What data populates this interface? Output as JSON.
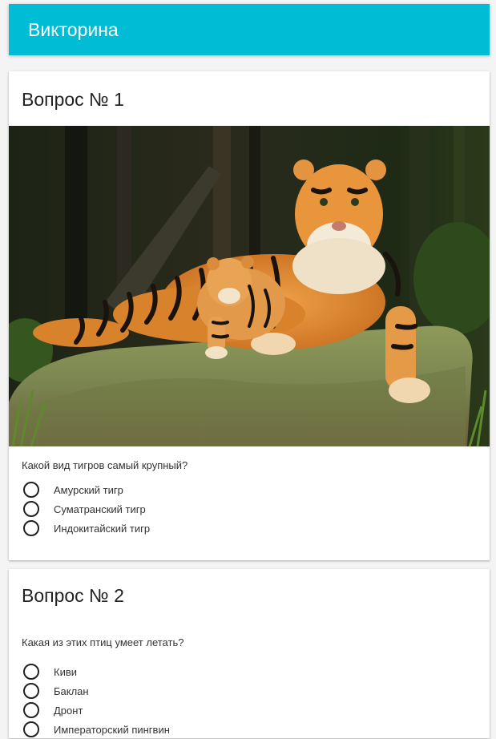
{
  "app": {
    "title": "Викторина"
  },
  "questions": [
    {
      "heading": "Вопрос № 1",
      "image": "tiger-with-cub-photo",
      "text": "Какой вид тигров самый крупный?",
      "options": [
        "Амурский тигр",
        "Суматранский тигр",
        "Индокитайский тигр"
      ]
    },
    {
      "heading": "Вопрос № 2",
      "text": "Какая из этих птиц умеет летать?",
      "options": [
        "Киви",
        "Баклан",
        "Дронт",
        "Императорский пингвин"
      ]
    }
  ],
  "colors": {
    "appbar": "#00bcd4",
    "background": "#f4f4f4",
    "card": "#ffffff"
  }
}
